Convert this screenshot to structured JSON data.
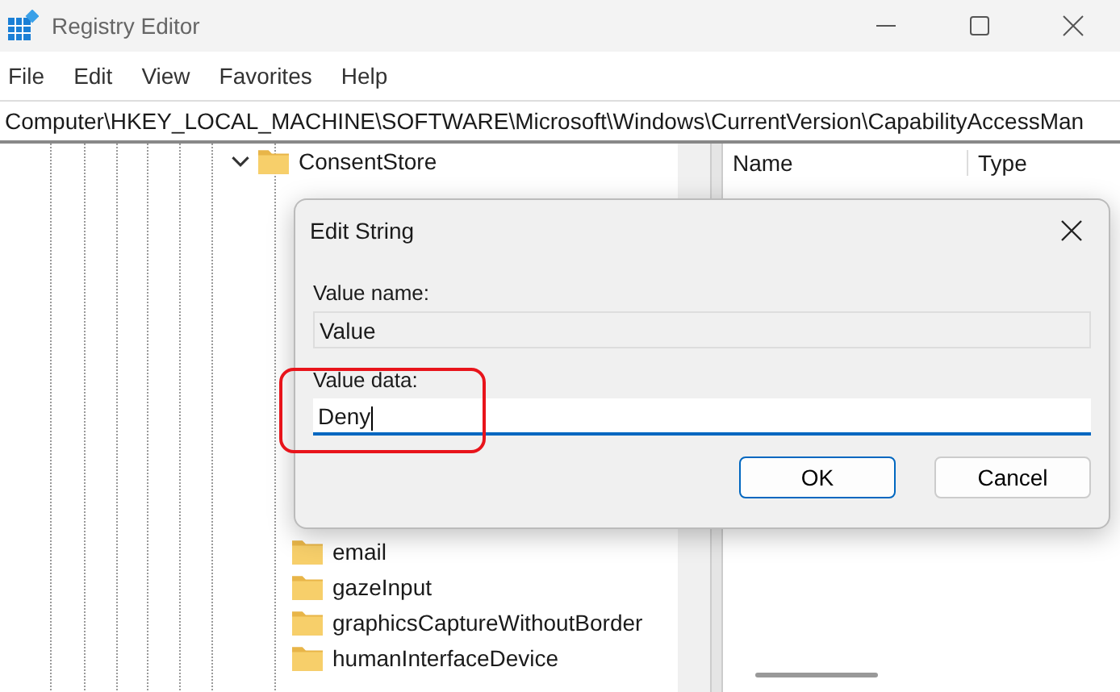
{
  "window": {
    "title": "Registry Editor"
  },
  "menu": [
    "File",
    "Edit",
    "View",
    "Favorites",
    "Help"
  ],
  "address": "Computer\\HKEY_LOCAL_MACHINE\\SOFTWARE\\Microsoft\\Windows\\CurrentVersion\\CapabilityAccessMan",
  "tree": {
    "label": "ConsentStore",
    "expanded": true,
    "children": [
      {
        "label": "email"
      },
      {
        "label": "gazeInput"
      },
      {
        "label": "graphicsCaptureWithoutBorder"
      },
      {
        "label": "humanInterfaceDevice"
      }
    ]
  },
  "list": {
    "columns": [
      "Name",
      "Type"
    ]
  },
  "dialog": {
    "title": "Edit String",
    "value_name_label": "Value name:",
    "value_name": "Value",
    "value_data_label": "Value data:",
    "value_data": "Deny",
    "buttons": [
      {
        "label": "OK",
        "default": true
      },
      {
        "label": "Cancel",
        "default": false
      }
    ]
  }
}
